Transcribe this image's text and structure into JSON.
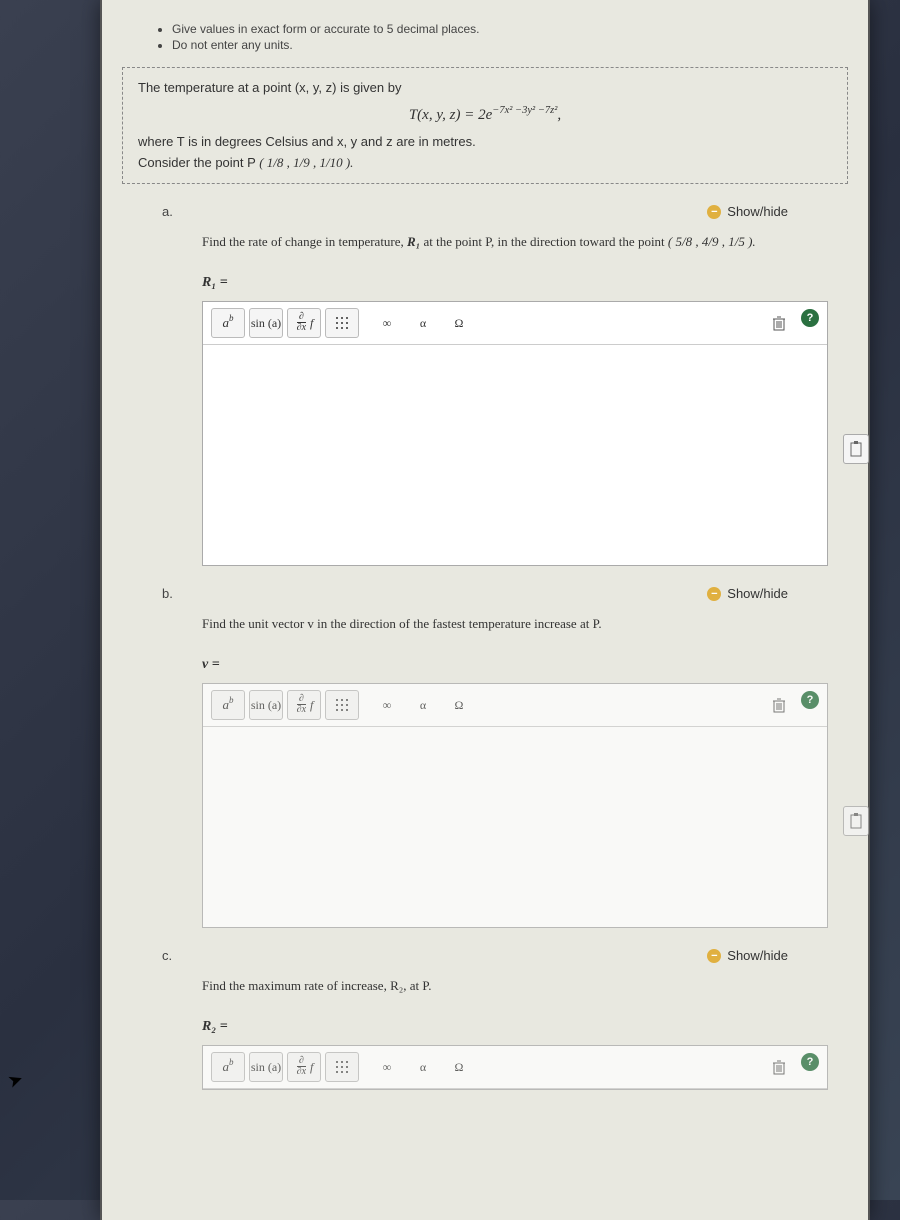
{
  "instructions": {
    "line1": "Give values in exact form or accurate to 5 decimal places.",
    "line2": "Do not enter any units."
  },
  "problem": {
    "intro": "The temperature at a point (x, y, z) is given by",
    "formula_lhs": "T(x, y, z) = 2e",
    "formula_exp": "−7x² −3y² −7z²",
    "formula_end": ",",
    "where": "where T is in degrees Celsius and x, y and z are in metres.",
    "consider": "Consider the point P",
    "point_frac": "( 1/8 , 1/9 , 1/10 )."
  },
  "showhide": "Show/hide",
  "parts": {
    "a": {
      "label": "a.",
      "question_pre": "Find the rate of change in temperature, ",
      "r1": "R₁",
      "question_mid": " at the point P, in the direction toward the point ",
      "target": "( 5/8 , 4/9 , 1/5 ).",
      "answer_label": "R₁ ="
    },
    "b": {
      "label": "b.",
      "question": "Find the unit vector v in the direction of the fastest temperature increase at P.",
      "answer_label": "v ="
    },
    "c": {
      "label": "c.",
      "question": "Find the maximum rate of increase, R₂, at P.",
      "answer_label": "R₂ ="
    }
  },
  "toolbar": {
    "ab": "a",
    "ab_sup": "b",
    "sin": "sin (a)",
    "partial_num": "∂",
    "partial_den": "∂x",
    "f": "f",
    "infinity": "∞",
    "alpha": "α",
    "omega": "Ω",
    "help": "?"
  }
}
